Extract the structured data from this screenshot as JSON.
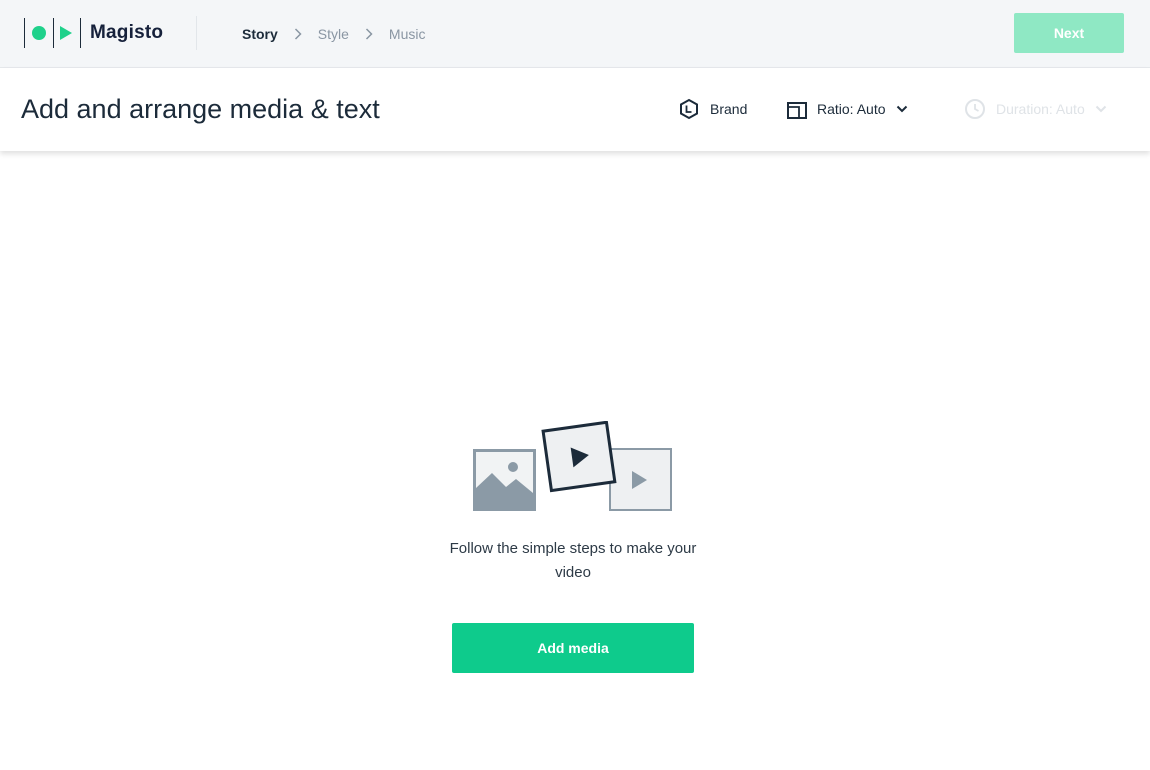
{
  "app": {
    "name": "Magisto"
  },
  "nav": {
    "steps": [
      {
        "label": "Story",
        "active": true
      },
      {
        "label": "Style",
        "active": false
      },
      {
        "label": "Music",
        "active": false
      }
    ],
    "next_label": "Next"
  },
  "header": {
    "title": "Add and arrange media & text",
    "brand_label": "Brand",
    "brand_icon": "brand-hexagon-icon",
    "ratio_label": "Ratio: Auto",
    "ratio_icon": "aspect-ratio-icon",
    "duration_label": "Duration: Auto",
    "duration_icon": "clock-icon"
  },
  "main": {
    "empty_message": "Follow the simple steps to make your video",
    "add_media_label": "Add media",
    "illustration_icons": [
      "image-icon",
      "video-icon",
      "video-icon"
    ]
  },
  "colors": {
    "accent": "#0ecb8c",
    "accent_disabled": "#8fe8c4",
    "logo_green": "#1fd18b",
    "text_dark": "#1c2b3a",
    "muted": "#8a96a3",
    "topbar_bg": "#f4f6f8"
  }
}
